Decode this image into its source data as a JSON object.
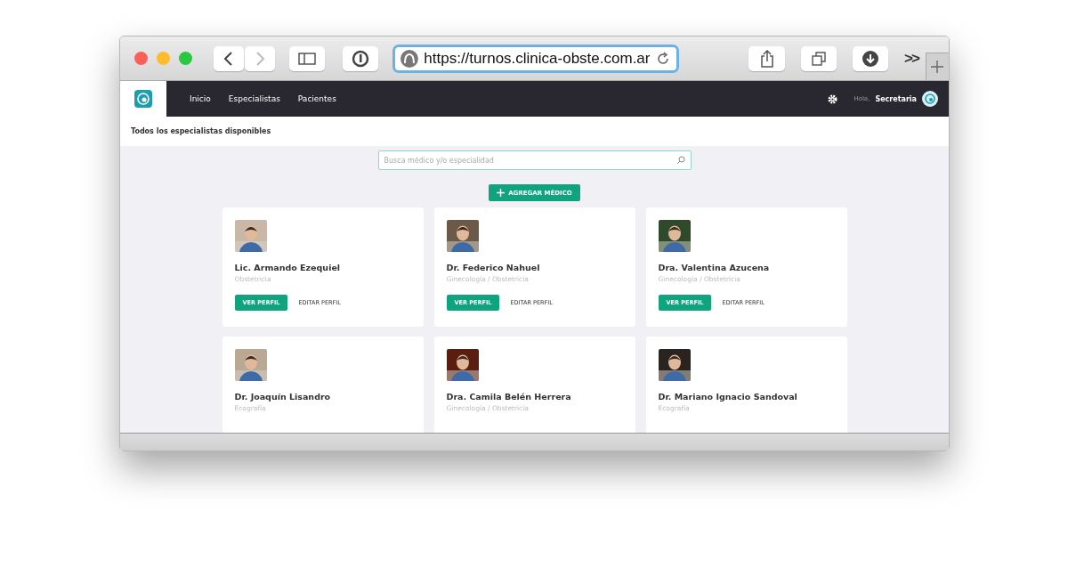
{
  "browser": {
    "url": "https://turnos.clinica-obste.com.ar",
    "more": ">>"
  },
  "navbar": {
    "items": [
      "Inicio",
      "Especialistas",
      "Pacientes"
    ],
    "greeting": "Hola,",
    "user": "Secretaria"
  },
  "page_title": "Todos los especialistas disponibles",
  "search": {
    "placeholder": "Busca médico y/o especialidad"
  },
  "add_button": "AGREGAR MÉDICO",
  "doctors": [
    {
      "name": "Lic. Armando Ezequiel",
      "specialty": "Obstetricia",
      "view_button": "VER PERFIL",
      "edit_button": "EDITAR PERFIL"
    },
    {
      "name": "Dr. Federico Nahuel",
      "specialty": "Ginecología / Obstetricia",
      "view_button": "VER PERFIL",
      "edit_button": "EDITAR PERFIL"
    },
    {
      "name": "Dra. Valentina Azucena",
      "specialty": "Ginecología / Obstetricia",
      "view_button": "VER PERFIL",
      "edit_button": "EDITAR PERFIL"
    },
    {
      "name": "Dr. Joaquín Lisandro",
      "specialty": "Ecografía"
    },
    {
      "name": "Dra. Camila Belén Herrera",
      "specialty": "Ginecología / Obstetricia"
    },
    {
      "name": "Dr. Mariano Ignacio Sandoval",
      "specialty": "Ecografía"
    }
  ]
}
